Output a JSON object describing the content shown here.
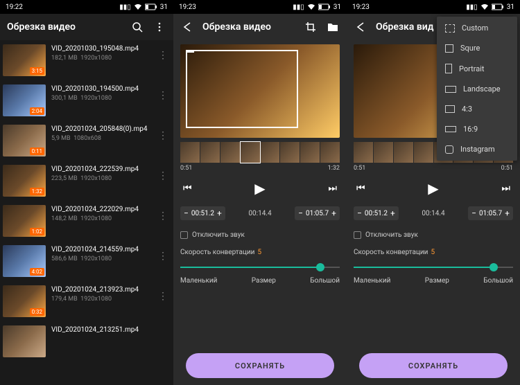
{
  "status": {
    "time_list": "19:22",
    "time_edit": "19:23",
    "battery": "31"
  },
  "list": {
    "title": "Обрезка видео",
    "items": [
      {
        "name": "VID_20201030_195048.mp4",
        "size": "182,1 MB",
        "res": "1920x1080",
        "duration": "3:15"
      },
      {
        "name": "VID_20201030_194500.mp4",
        "size": "300,1 MB",
        "res": "1920x1080",
        "duration": "2:04"
      },
      {
        "name": "VID_20201024_205848(0).mp4",
        "size": "5,9 MB",
        "res": "1080x608",
        "duration": "0:11"
      },
      {
        "name": "VID_20201024_222539.mp4",
        "size": "223,5 MB",
        "res": "1920x1080",
        "duration": "1:32"
      },
      {
        "name": "VID_20201024_222029.mp4",
        "size": "148,2 MB",
        "res": "1920x1080",
        "duration": "1:02"
      },
      {
        "name": "VID_20201024_214559.mp4",
        "size": "586,6 MB",
        "res": "1920x1080",
        "duration": "4:02"
      },
      {
        "name": "VID_20201024_213923.mp4",
        "size": "179,4 MB",
        "res": "1920x1080",
        "duration": "0:32"
      },
      {
        "name": "VID_20201024_213251.mp4",
        "size": "",
        "res": "",
        "duration": ""
      }
    ]
  },
  "editor": {
    "title": "Обрезка видео",
    "title_truncated": "Обрезка вид",
    "timeline": {
      "start": "0:51",
      "end": "1:32",
      "alt_end": "0:51"
    },
    "trim": {
      "left": "00:51.2",
      "center": "00:14.4",
      "right": "01:05.7"
    },
    "mute_label": "Отключить звук",
    "speed_label": "Скорость конвертации",
    "speed_value": "5",
    "size_small": "Маленький",
    "size_mid": "Размер",
    "size_large": "Большой",
    "save": "СОХРАНЯТЬ"
  },
  "crop_menu": {
    "items": [
      {
        "label": "Custom"
      },
      {
        "label": "Squre"
      },
      {
        "label": "Portrait"
      },
      {
        "label": "Landscape"
      },
      {
        "label": "4:3"
      },
      {
        "label": "16:9"
      },
      {
        "label": "Instagram"
      }
    ]
  }
}
